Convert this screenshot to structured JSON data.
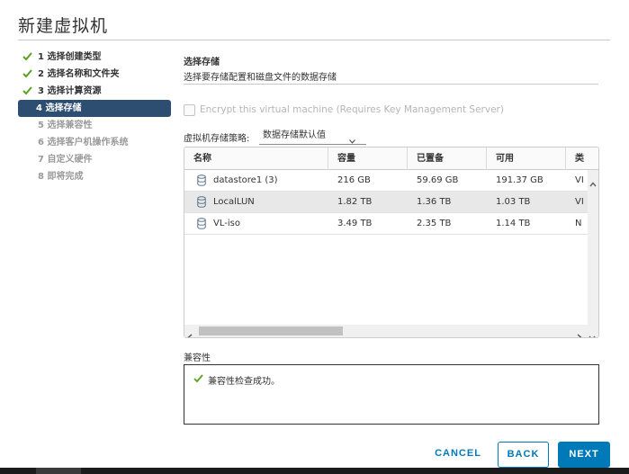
{
  "dialog": {
    "title": "新建虚拟机"
  },
  "steps": [
    {
      "label": "1 选择创建类型",
      "state": "done"
    },
    {
      "label": "2 选择名称和文件夹",
      "state": "done"
    },
    {
      "label": "3 选择计算资源",
      "state": "done"
    },
    {
      "label": "4 选择存储",
      "state": "active"
    },
    {
      "label": "5 选择兼容性",
      "state": "todo"
    },
    {
      "label": "6 选择客户机操作系统",
      "state": "todo"
    },
    {
      "label": "7 自定义硬件",
      "state": "todo"
    },
    {
      "label": "8 即将完成",
      "state": "todo"
    }
  ],
  "storage": {
    "heading": "选择存储",
    "description": "选择要存储配置和磁盘文件的数据存储",
    "encrypt_label": "Encrypt this virtual machine (Requires Key Management Server)",
    "encrypt_checked": false,
    "policy_label": "虚拟机存储策略:",
    "policy_value": "数据存储默认值"
  },
  "grid": {
    "columns": [
      "名称",
      "容量",
      "已置备",
      "可用",
      "类"
    ],
    "rows": [
      {
        "name": "datastore1 (3)",
        "capacity": "216 GB",
        "provisioned": "59.69 GB",
        "free": "191.37 GB",
        "type": "VI",
        "selected": false
      },
      {
        "name": "LocalLUN",
        "capacity": "1.82 TB",
        "provisioned": "1.36 TB",
        "free": "1.03 TB",
        "type": "VI",
        "selected": true
      },
      {
        "name": "VL-iso",
        "capacity": "3.49 TB",
        "provisioned": "2.35 TB",
        "free": "1.14 TB",
        "type": "N",
        "selected": false
      }
    ]
  },
  "compatibility": {
    "label": "兼容性",
    "message": "兼容性检查成功。"
  },
  "buttons": {
    "cancel": "CANCEL",
    "back": "BACK",
    "next": "NEXT"
  },
  "colors": {
    "accent": "#0079b8",
    "active_step_bg": "#2e4e71",
    "check_green": "#5aa220"
  },
  "icons": {
    "step_done": "checkmark-icon",
    "datastore": "database-icon",
    "success": "checkmark-icon"
  }
}
